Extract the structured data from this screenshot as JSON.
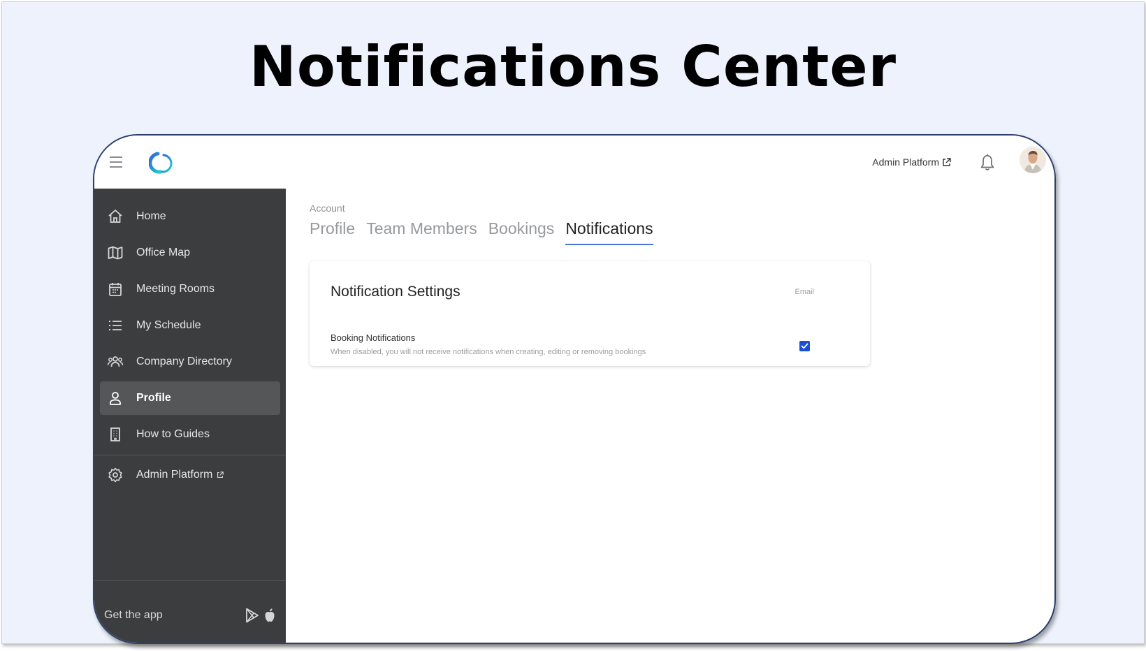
{
  "slide": {
    "title": "Notifications Center"
  },
  "topbar": {
    "admin_link": "Admin Platform",
    "icons": [
      "menu-icon",
      "app-logo",
      "external-link-icon",
      "bell-icon",
      "avatar"
    ]
  },
  "sidebar": {
    "items": [
      {
        "label": "Home",
        "icon": "home-icon"
      },
      {
        "label": "Office Map",
        "icon": "map-icon"
      },
      {
        "label": "Meeting Rooms",
        "icon": "calendar-icon"
      },
      {
        "label": "My Schedule",
        "icon": "list-icon"
      },
      {
        "label": "Company Directory",
        "icon": "people-icon"
      },
      {
        "label": "Profile",
        "icon": "user-icon",
        "active": true
      },
      {
        "label": "How to Guides",
        "icon": "building-icon"
      },
      {
        "label": "Admin Platform",
        "icon": "gear-icon"
      }
    ],
    "get_app": "Get the app"
  },
  "main": {
    "breadcrumb": "Account",
    "tabs": [
      {
        "label": "Profile"
      },
      {
        "label": "Team Members"
      },
      {
        "label": "Bookings"
      },
      {
        "label": "Notifications",
        "active": true
      }
    ],
    "card": {
      "title": "Notification Settings",
      "column": "Email",
      "setting": {
        "name": "Booking Notifications",
        "description": "When disabled, you will not receive notifications when creating, editing or removing bookings",
        "email_checked": true
      }
    }
  },
  "colors": {
    "slide_bg": "#edf2fc",
    "sidebar_bg": "#3c3d3f",
    "sidebar_active": "#555658",
    "tab_underline": "#4a72d8",
    "checkbox": "#1a4fd6"
  }
}
